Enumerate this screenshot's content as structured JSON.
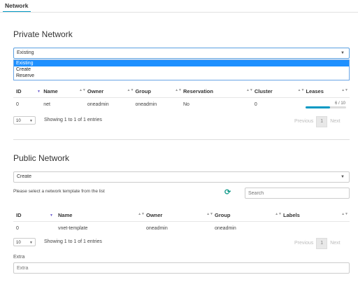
{
  "tab": {
    "label": "Network"
  },
  "private": {
    "title": "Private Network",
    "select_value": "Existing",
    "options": [
      "Existing",
      "Create",
      "Reserve"
    ],
    "columns": [
      "ID",
      "Name",
      "Owner",
      "Group",
      "Reservation",
      "Cluster",
      "Leases"
    ],
    "rows": [
      {
        "id": "0",
        "name": "net",
        "owner": "oneadmin",
        "group": "oneadmin",
        "reservation": "No",
        "cluster": "0",
        "leases": "6 / 10",
        "leases_fraction": 0.6
      }
    ],
    "page_length": "10",
    "info": "Showing 1 to 1 of 1 entries",
    "pager": {
      "previous": "Previous",
      "current": "1",
      "next": "Next"
    }
  },
  "public": {
    "title": "Public Network",
    "select_value": "Create",
    "hint": "Please select a network template from the list",
    "search_placeholder": "Search",
    "columns": [
      "ID",
      "Name",
      "Owner",
      "Group",
      "Labels"
    ],
    "rows": [
      {
        "id": "0",
        "name": "vnet-template",
        "owner": "oneadmin",
        "group": "oneadmin",
        "labels": ""
      }
    ],
    "page_length": "10",
    "info": "Showing 1 to 1 of 1 entries",
    "pager": {
      "previous": "Previous",
      "current": "1",
      "next": "Next"
    }
  },
  "extra": {
    "label": "Extra",
    "placeholder": "Extra"
  },
  "colors": {
    "accent": "#0098c3",
    "selected_option": "#1e90ff",
    "refresh_icon": "#1a9e8f"
  }
}
